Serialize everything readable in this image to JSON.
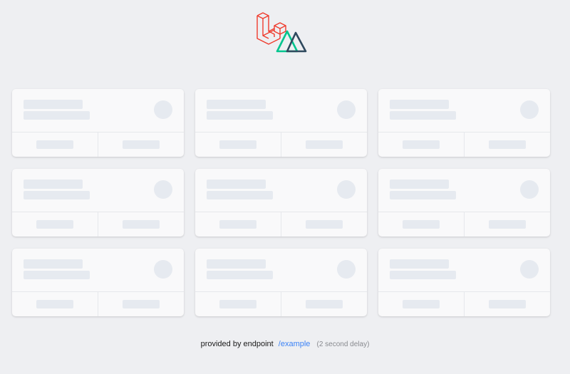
{
  "header": {
    "logos": [
      "laravel-icon",
      "nuxt-icon"
    ]
  },
  "cards": {
    "count": 9,
    "state": "loading"
  },
  "footer": {
    "prefix": "provided by endpoint",
    "endpoint": "/example",
    "delay_note": "(2 second delay)"
  },
  "colors": {
    "background": "#eeeff2",
    "card": "#f9f9fa",
    "skeleton": "#e6eaf0",
    "link": "#3b82f6",
    "laravel": "#ef3b2d",
    "nuxt_green": "#00c58e",
    "nuxt_dark": "#2f495e"
  }
}
